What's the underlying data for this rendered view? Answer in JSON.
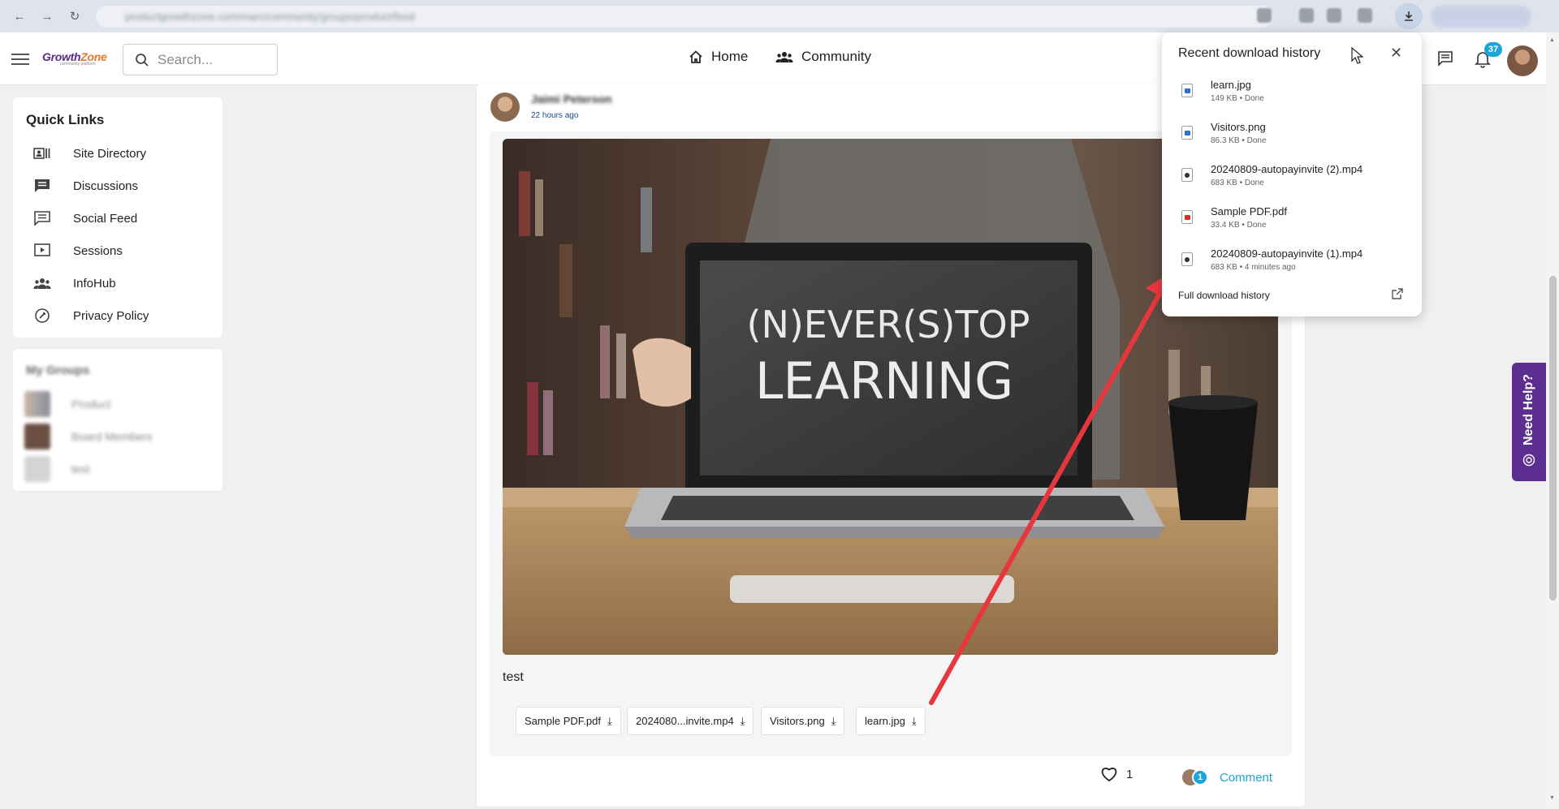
{
  "browser": {
    "url": "productgrowthzone.com/marc/community/groups/product/feed"
  },
  "header": {
    "logo": {
      "brand_main": "Growth",
      "brand_accent": "Zone",
      "tagline": "community platform"
    },
    "search_placeholder": "Search...",
    "nav": [
      {
        "label": "Home",
        "icon": "home-icon"
      },
      {
        "label": "Community",
        "icon": "people-icon"
      }
    ],
    "notification_count": "37"
  },
  "sidebar": {
    "quick_links_title": "Quick Links",
    "quick_links": [
      {
        "label": "Site Directory",
        "icon": "directory-icon"
      },
      {
        "label": "Discussions",
        "icon": "discussion-icon"
      },
      {
        "label": "Social Feed",
        "icon": "feed-icon"
      },
      {
        "label": "Sessions",
        "icon": "video-icon"
      },
      {
        "label": "InfoHub",
        "icon": "people-icon"
      },
      {
        "label": "Privacy Policy",
        "icon": "privacy-icon"
      }
    ],
    "groups_title": "My Groups",
    "groups": [
      {
        "label": "Product"
      },
      {
        "label": "Board Members"
      },
      {
        "label": "test"
      }
    ]
  },
  "post": {
    "author": "Jaimi Peterson",
    "time": "22 hours ago",
    "image_text": {
      "line1": "(N)EVER(S)TOP",
      "line2": "LEARNING"
    },
    "body": "test",
    "attachments": [
      {
        "label": "Sample PDF.pdf"
      },
      {
        "label": "2024080...invite.mp4"
      },
      {
        "label": "Visitors.png"
      },
      {
        "label": "learn.jpg"
      }
    ],
    "like_count": "1",
    "comment_count": "1",
    "comment_label": "Comment"
  },
  "downloads": {
    "title": "Recent download history",
    "items": [
      {
        "name": "learn.jpg",
        "meta": "149 KB • Done",
        "type": "image"
      },
      {
        "name": "Visitors.png",
        "meta": "86.3 KB • Done",
        "type": "image"
      },
      {
        "name": "20240809-autopayinvite (2).mp4",
        "meta": "683 KB • Done",
        "type": "video"
      },
      {
        "name": "Sample PDF.pdf",
        "meta": "33.4 KB • Done",
        "type": "pdf"
      },
      {
        "name": "20240809-autopayinvite (1).mp4",
        "meta": "683 KB • 4 minutes ago",
        "type": "video"
      }
    ],
    "full_history_label": "Full download history"
  },
  "help_widget": {
    "label": "Need Help?"
  },
  "colors": {
    "accent": "#1aa4d8",
    "brand_purple": "#5c2e8f",
    "brand_orange": "#e8792b",
    "annotation_arrow": "#e8373c"
  }
}
